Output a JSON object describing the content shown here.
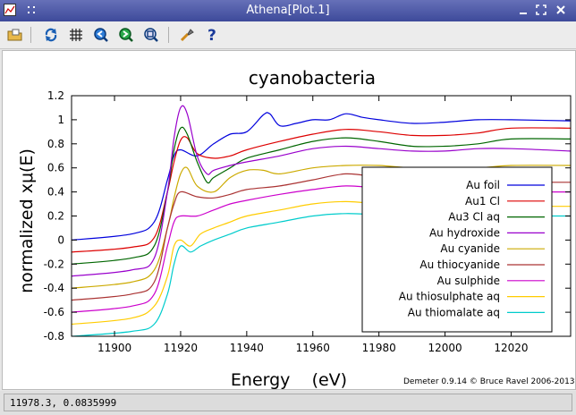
{
  "window": {
    "title": "Athena[Plot.1]"
  },
  "toolbar": {
    "icons": [
      "open-folder-icon",
      "refresh-icon",
      "grid-icon",
      "zoom-in-icon",
      "zoom-out-icon",
      "zoom-reset-icon",
      "settings-icon",
      "help-icon"
    ]
  },
  "status": {
    "text": "11978.3,  0.0835999"
  },
  "footer": {
    "credit": "Demeter 0.9.14 © Bruce Ravel 2006-2013"
  },
  "chart_data": {
    "type": "line",
    "title": "cyanobacteria",
    "xlabel": "Energy    (eV)",
    "ylabel": "normalized xμ(E)",
    "xlim": [
      11887,
      12038
    ],
    "ylim": [
      -0.8,
      1.2
    ],
    "x_ticks": [
      11900,
      11920,
      11940,
      11960,
      11980,
      12000,
      12020
    ],
    "y_ticks": [
      -0.8,
      -0.6,
      -0.4,
      -0.2,
      0,
      0.2,
      0.4,
      0.6,
      0.8,
      1,
      1.2
    ],
    "grid": false,
    "legend": "bottom-right",
    "series": [
      {
        "name": "Au foil",
        "color": "#0000dd",
        "points": [
          [
            11887,
            0.0
          ],
          [
            11905,
            0.05
          ],
          [
            11912,
            0.15
          ],
          [
            11916,
            0.5
          ],
          [
            11918,
            0.7
          ],
          [
            11920,
            0.75
          ],
          [
            11925,
            0.7
          ],
          [
            11930,
            0.8
          ],
          [
            11935,
            0.88
          ],
          [
            11940,
            0.9
          ],
          [
            11945,
            1.04
          ],
          [
            11947,
            1.05
          ],
          [
            11950,
            0.95
          ],
          [
            11955,
            0.97
          ],
          [
            11960,
            1.0
          ],
          [
            11965,
            1.0
          ],
          [
            11970,
            1.05
          ],
          [
            11975,
            1.02
          ],
          [
            11980,
            1.0
          ],
          [
            11990,
            0.97
          ],
          [
            12000,
            0.98
          ],
          [
            12010,
            1.0
          ],
          [
            12020,
            1.0
          ],
          [
            12038,
            0.99
          ]
        ]
      },
      {
        "name": "Au1 Cl",
        "color": "#dd0000",
        "points": [
          [
            11887,
            -0.1
          ],
          [
            11905,
            -0.06
          ],
          [
            11912,
            0.02
          ],
          [
            11916,
            0.4
          ],
          [
            11918,
            0.65
          ],
          [
            11920,
            0.83
          ],
          [
            11922,
            0.85
          ],
          [
            11925,
            0.72
          ],
          [
            11930,
            0.68
          ],
          [
            11935,
            0.7
          ],
          [
            11940,
            0.75
          ],
          [
            11950,
            0.82
          ],
          [
            11960,
            0.88
          ],
          [
            11970,
            0.92
          ],
          [
            11980,
            0.9
          ],
          [
            11990,
            0.87
          ],
          [
            12000,
            0.87
          ],
          [
            12010,
            0.89
          ],
          [
            12020,
            0.93
          ],
          [
            12038,
            0.93
          ]
        ]
      },
      {
        "name": "Au3 Cl aq",
        "color": "#006600",
        "points": [
          [
            11887,
            -0.2
          ],
          [
            11905,
            -0.15
          ],
          [
            11912,
            -0.05
          ],
          [
            11916,
            0.4
          ],
          [
            11918,
            0.75
          ],
          [
            11920,
            0.93
          ],
          [
            11922,
            0.88
          ],
          [
            11925,
            0.65
          ],
          [
            11928,
            0.48
          ],
          [
            11930,
            0.52
          ],
          [
            11935,
            0.6
          ],
          [
            11940,
            0.68
          ],
          [
            11950,
            0.75
          ],
          [
            11960,
            0.82
          ],
          [
            11970,
            0.85
          ],
          [
            11980,
            0.82
          ],
          [
            11990,
            0.78
          ],
          [
            12000,
            0.78
          ],
          [
            12010,
            0.8
          ],
          [
            12020,
            0.84
          ],
          [
            12038,
            0.84
          ]
        ]
      },
      {
        "name": "Au hydroxide",
        "color": "#9900cc",
        "points": [
          [
            11887,
            -0.3
          ],
          [
            11905,
            -0.25
          ],
          [
            11912,
            -0.15
          ],
          [
            11916,
            0.4
          ],
          [
            11918,
            0.85
          ],
          [
            11920,
            1.1
          ],
          [
            11922,
            1.05
          ],
          [
            11925,
            0.7
          ],
          [
            11928,
            0.55
          ],
          [
            11930,
            0.58
          ],
          [
            11935,
            0.62
          ],
          [
            11940,
            0.65
          ],
          [
            11950,
            0.7
          ],
          [
            11960,
            0.76
          ],
          [
            11970,
            0.78
          ],
          [
            11980,
            0.76
          ],
          [
            11990,
            0.74
          ],
          [
            12000,
            0.74
          ],
          [
            12010,
            0.76
          ],
          [
            12020,
            0.76
          ],
          [
            12038,
            0.74
          ]
        ]
      },
      {
        "name": "Au cyanide",
        "color": "#ccaa00",
        "points": [
          [
            11887,
            -0.4
          ],
          [
            11905,
            -0.35
          ],
          [
            11912,
            -0.25
          ],
          [
            11916,
            0.1
          ],
          [
            11918,
            0.35
          ],
          [
            11920,
            0.55
          ],
          [
            11922,
            0.6
          ],
          [
            11925,
            0.45
          ],
          [
            11930,
            0.4
          ],
          [
            11935,
            0.52
          ],
          [
            11940,
            0.58
          ],
          [
            11945,
            0.58
          ],
          [
            11950,
            0.55
          ],
          [
            11960,
            0.6
          ],
          [
            11970,
            0.62
          ],
          [
            11980,
            0.62
          ],
          [
            11990,
            0.6
          ],
          [
            12000,
            0.6
          ],
          [
            12010,
            0.6
          ],
          [
            12020,
            0.62
          ],
          [
            12038,
            0.62
          ]
        ]
      },
      {
        "name": "Au thiocyanide",
        "color": "#aa3333",
        "points": [
          [
            11887,
            -0.5
          ],
          [
            11905,
            -0.45
          ],
          [
            11912,
            -0.35
          ],
          [
            11916,
            0.1
          ],
          [
            11918,
            0.3
          ],
          [
            11920,
            0.4
          ],
          [
            11925,
            0.36
          ],
          [
            11930,
            0.35
          ],
          [
            11935,
            0.38
          ],
          [
            11940,
            0.42
          ],
          [
            11950,
            0.45
          ],
          [
            11960,
            0.5
          ],
          [
            11970,
            0.55
          ],
          [
            11980,
            0.52
          ],
          [
            11990,
            0.48
          ],
          [
            12000,
            0.47
          ],
          [
            12010,
            0.48
          ],
          [
            12020,
            0.48
          ],
          [
            12038,
            0.48
          ]
        ]
      },
      {
        "name": "Au sulphide",
        "color": "#cc00cc",
        "points": [
          [
            11887,
            -0.6
          ],
          [
            11905,
            -0.55
          ],
          [
            11912,
            -0.45
          ],
          [
            11916,
            -0.05
          ],
          [
            11918,
            0.15
          ],
          [
            11920,
            0.2
          ],
          [
            11925,
            0.2
          ],
          [
            11930,
            0.25
          ],
          [
            11935,
            0.3
          ],
          [
            11940,
            0.33
          ],
          [
            11950,
            0.38
          ],
          [
            11960,
            0.42
          ],
          [
            11970,
            0.45
          ],
          [
            11980,
            0.43
          ],
          [
            11990,
            0.4
          ],
          [
            12000,
            0.4
          ],
          [
            12010,
            0.4
          ],
          [
            12020,
            0.4
          ],
          [
            12038,
            0.4
          ]
        ]
      },
      {
        "name": "Au thiosulphate aq",
        "color": "#ffcc00",
        "points": [
          [
            11887,
            -0.7
          ],
          [
            11905,
            -0.65
          ],
          [
            11912,
            -0.55
          ],
          [
            11916,
            -0.3
          ],
          [
            11918,
            -0.05
          ],
          [
            11920,
            0.0
          ],
          [
            11923,
            -0.05
          ],
          [
            11926,
            0.05
          ],
          [
            11930,
            0.1
          ],
          [
            11935,
            0.15
          ],
          [
            11940,
            0.2
          ],
          [
            11950,
            0.25
          ],
          [
            11960,
            0.3
          ],
          [
            11970,
            0.32
          ],
          [
            11980,
            0.3
          ],
          [
            11990,
            0.28
          ],
          [
            12000,
            0.27
          ],
          [
            12010,
            0.28
          ],
          [
            12020,
            0.28
          ],
          [
            12038,
            0.28
          ]
        ]
      },
      {
        "name": "Au thiomalate aq",
        "color": "#00cccc",
        "points": [
          [
            11887,
            -0.8
          ],
          [
            11905,
            -0.76
          ],
          [
            11912,
            -0.7
          ],
          [
            11916,
            -0.45
          ],
          [
            11918,
            -0.2
          ],
          [
            11920,
            -0.05
          ],
          [
            11923,
            -0.1
          ],
          [
            11926,
            -0.05
          ],
          [
            11930,
            0.0
          ],
          [
            11935,
            0.05
          ],
          [
            11940,
            0.1
          ],
          [
            11950,
            0.15
          ],
          [
            11960,
            0.2
          ],
          [
            11970,
            0.22
          ],
          [
            11980,
            0.21
          ],
          [
            11990,
            0.2
          ],
          [
            12000,
            0.2
          ],
          [
            12010,
            0.2
          ],
          [
            12020,
            0.2
          ],
          [
            12038,
            0.2
          ]
        ]
      }
    ]
  }
}
